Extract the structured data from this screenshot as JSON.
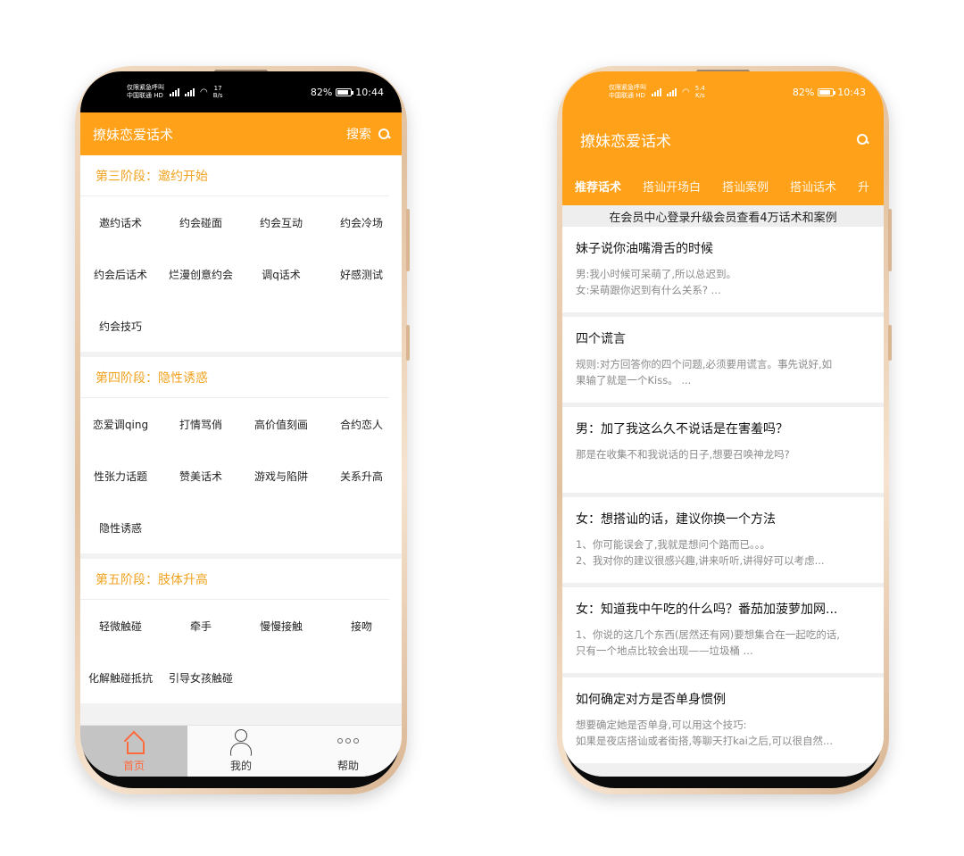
{
  "left_phone": {
    "status": {
      "carrier_line1": "仅限紧急呼叫",
      "carrier_line2": "中国联通 HD",
      "net_speed_value": "17",
      "net_speed_unit": "B/s",
      "battery": "82%",
      "time": "10:44"
    },
    "header": {
      "title": "撩妹恋爱话术",
      "search_label": "搜索"
    },
    "stages": [
      {
        "title": "第三阶段：邀约开始",
        "items": [
          "邀约话术",
          "约会碰面",
          "约会互动",
          "约会冷场",
          "约会后话术",
          "烂漫创意约会",
          "调q话术",
          "好感测试",
          "约会技巧"
        ]
      },
      {
        "title": "第四阶段：隐性诱惑",
        "items": [
          "恋爱调qing",
          "打情骂俏",
          "高价值刻画",
          "合约恋人",
          "性张力话题",
          "赞美话术",
          "游戏与陷阱",
          "关系升高",
          "隐性诱惑"
        ]
      },
      {
        "title": "第五阶段：肢体升高",
        "items": [
          "轻微触碰",
          "牵手",
          "慢慢接触",
          "接吻",
          "化解触碰抵抗",
          "引导女孩触碰"
        ]
      }
    ],
    "tabbar": {
      "home": "首页",
      "mine": "我的",
      "help": "帮助"
    }
  },
  "right_phone": {
    "status": {
      "carrier_line1": "仅限紧急呼叫",
      "carrier_line2": "中国联通 HD",
      "net_speed_value": "5.4",
      "net_speed_unit": "K/s",
      "battery": "82%",
      "time": "10:43"
    },
    "header": {
      "title": "撩妹恋爱话术"
    },
    "tabs": [
      "推荐话术",
      "搭讪开场白",
      "搭讪案例",
      "搭讪话术",
      "升"
    ],
    "banner": "在会员中心登录升级会员查看4万话术和案例",
    "articles": [
      {
        "title": "妹子说你油嘴滑舌的时候",
        "lines": [
          "男:我小时候可呆萌了,所以总迟到。",
          "女:呆萌跟你迟到有什么关系? ..."
        ]
      },
      {
        "title": "四个谎言",
        "lines": [
          "规则:对方回答你的四个问题,必须要用谎言。事先说好,如",
          "果输了就是一个Kiss。 ..."
        ]
      },
      {
        "title": "男：加了我这么久不说话是在害羞吗？",
        "lines": [
          "那是在收集不和我说话的日子,想要召唤神龙吗?"
        ]
      },
      {
        "title": "女：想搭讪的话，建议你换一个方法",
        "lines": [
          "1、你可能误会了,我就是想问个路而已。。。",
          "2、我对你的建议很感兴趣,讲来听听,讲得好可以考虑..."
        ]
      },
      {
        "title": "女：知道我中午吃的什么吗？番茄加菠萝加网...",
        "lines": [
          "1、你说的这几个东西(居然还有网)要想集合在一起吃的话,",
          "只有一个地点比较会出现——垃圾桶 ..."
        ]
      },
      {
        "title": "如何确定对方是否单身惯例",
        "lines": [
          "想要确定她是否单身,可以用这个技巧:",
          "如果是夜店搭讪或者街搭,等聊天打kai之后,可以很自然..."
        ]
      }
    ]
  },
  "colors": {
    "accent": "#ffa21a",
    "stage_title": "#f0a320",
    "tab_active": "#ff6a3d",
    "frame_gold": "#e2c19f"
  }
}
